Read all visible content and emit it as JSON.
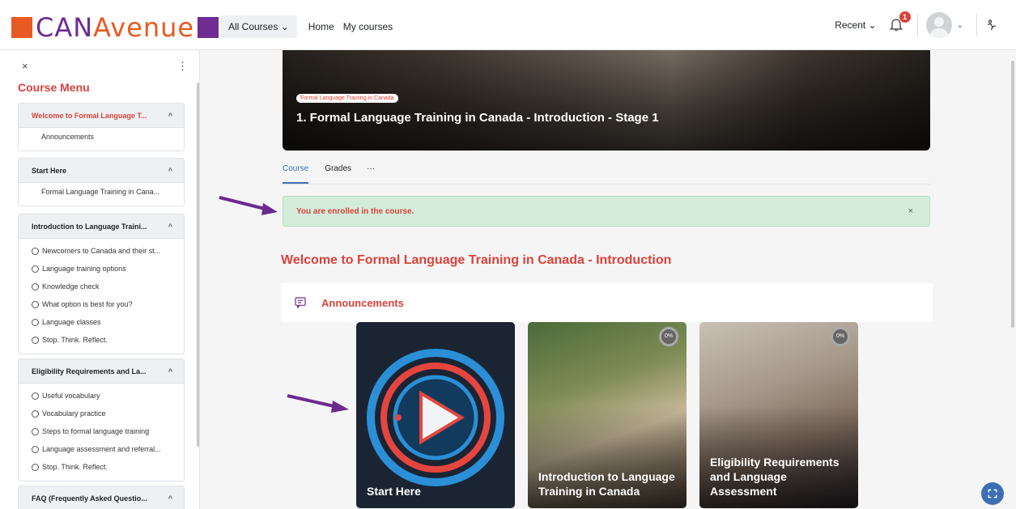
{
  "navbar": {
    "logo_text_a": "CAN",
    "logo_text_b": "Avenue",
    "all_courses": "All Courses ⌄",
    "links": [
      "Home",
      "My courses"
    ],
    "recent": "Recent ⌄",
    "notification_count": "1",
    "colors": {
      "brand_orange": "#e85a23",
      "brand_purple": "#6f2c91"
    }
  },
  "sidebar": {
    "close": "×",
    "menu": "⋮",
    "title": "Course Menu",
    "sections": [
      {
        "title": "Welcome to Formal Language T...",
        "items": [
          "Announcements"
        ]
      },
      {
        "title": "Start Here",
        "items": [
          "Formal Language Training in Cana..."
        ]
      },
      {
        "title": "Introduction to Language Traini...",
        "items": [
          "Newcomers to Canada and their st...",
          "Language training options",
          "Knowledge check",
          "What option is best for you?",
          "Language classes",
          "Stop. Think. Reflect."
        ]
      },
      {
        "title": "Eligibility Requirements and La...",
        "items": [
          "Useful vocabulary",
          "Vocabulary practice",
          "Steps to formal language training",
          "Language assessment and referral...",
          "Stop. Think. Reflect."
        ]
      },
      {
        "title": "FAQ (Frequently Asked Questio..."
      }
    ]
  },
  "hero": {
    "badge": "Formal Language Training in Canada",
    "title": "1. Formal Language Training in Canada - Introduction - Stage 1"
  },
  "tabs": [
    "Course",
    "Grades",
    "···"
  ],
  "alert": {
    "text": "You are enrolled in the course.",
    "close": "×"
  },
  "welcome_heading": "Welcome to Formal Language Training in Canada - Introduction",
  "announcements": "Announcements",
  "cards": [
    {
      "label": "Start Here"
    },
    {
      "label": "Introduction to Language Training in Canada",
      "progress": "0%"
    },
    {
      "label": "Eligibility Requirements and Language Assessment",
      "progress": "0%"
    }
  ]
}
